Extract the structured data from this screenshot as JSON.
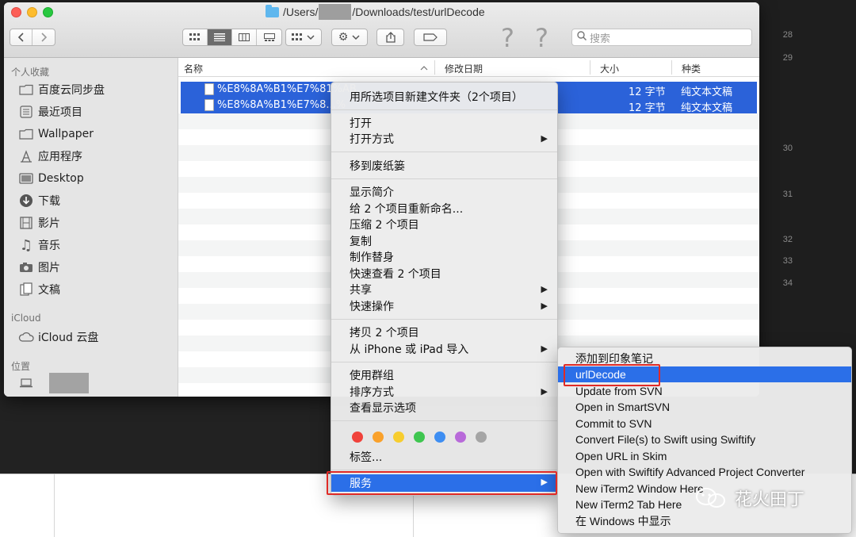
{
  "window": {
    "title_prefix": "/Users/",
    "title_suffix": "/Downloads/test/urlDecode"
  },
  "toolbar": {
    "search_placeholder": "搜索",
    "help_glyph": "?"
  },
  "calendar": {
    "day_numbers": [
      "28",
      "29",
      "30",
      "31",
      "32",
      "33",
      "34"
    ]
  },
  "sidebar": {
    "favorites_heading": "个人收藏",
    "favorites": [
      {
        "label": "百度云同步盘",
        "icon": "folder-icon"
      },
      {
        "label": "最近项目",
        "icon": "recent-icon"
      },
      {
        "label": "Wallpaper",
        "icon": "folder-icon"
      },
      {
        "label": "应用程序",
        "icon": "applications-icon"
      },
      {
        "label": "Desktop",
        "icon": "desktop-icon"
      },
      {
        "label": "下载",
        "icon": "download-icon"
      },
      {
        "label": "影片",
        "icon": "movies-icon"
      },
      {
        "label": "音乐",
        "icon": "music-icon"
      },
      {
        "label": "图片",
        "icon": "pictures-icon"
      },
      {
        "label": "文稿",
        "icon": "documents-icon"
      }
    ],
    "icloud_heading": "iCloud",
    "icloud_items": [
      {
        "label": "iCloud 云盘",
        "icon": "cloud-icon"
      }
    ],
    "locations_heading": "位置"
  },
  "file_list": {
    "columns": {
      "name": "名称",
      "modified": "修改日期",
      "size": "大小",
      "kind": "种类"
    },
    "rows": [
      {
        "name": "%E8%8A%B1%E7%81%AB...",
        "size": "12 字节",
        "kind": "纯文本文稿"
      },
      {
        "name": "%E8%8A%B1%E7%8...%",
        "size": "12 字节",
        "kind": "纯文本文稿"
      }
    ]
  },
  "context_menu": {
    "new_folder": "用所选项目新建文件夹（2个项目）",
    "open": "打开",
    "open_with": "打开方式",
    "move_to_trash": "移到废纸篓",
    "get_info": "显示简介",
    "rename": "给 2 个项目重新命名...",
    "compress": "压缩 2 个项目",
    "duplicate": "复制",
    "make_alias": "制作替身",
    "quick_look": "快速查看 2 个项目",
    "share": "共享",
    "quick_actions": "快速操作",
    "copy": "拷贝 2 个项目",
    "import_from_iphone": "从 iPhone 或 iPad 导入",
    "use_groups": "使用群组",
    "sort_by": "排序方式",
    "view_options": "查看显示选项",
    "tags_label": "标签...",
    "services": "服务",
    "tag_colors": [
      "#f0423b",
      "#f9a12b",
      "#f7cd2f",
      "#3fc650",
      "#3e8ef2",
      "#b86ad9",
      "#a5a5a5"
    ]
  },
  "services_menu": {
    "items": [
      "添加到印象笔记",
      "urlDecode",
      "Update from SVN",
      "Open in SmartSVN",
      "Commit to SVN",
      "Convert File(s) to Swift using Swiftify",
      "Open URL in Skim",
      "Open with Swiftify Advanced Project Converter",
      "New iTerm2 Window Here",
      "New iTerm2 Tab Here",
      "在 Windows 中显示"
    ],
    "highlighted": "urlDecode"
  },
  "watermark": {
    "text": "花火田丁"
  },
  "colors": {
    "selection": "#2b62d9",
    "menu_highlight": "#2b6fe8",
    "annotation_red": "#e02a26"
  }
}
